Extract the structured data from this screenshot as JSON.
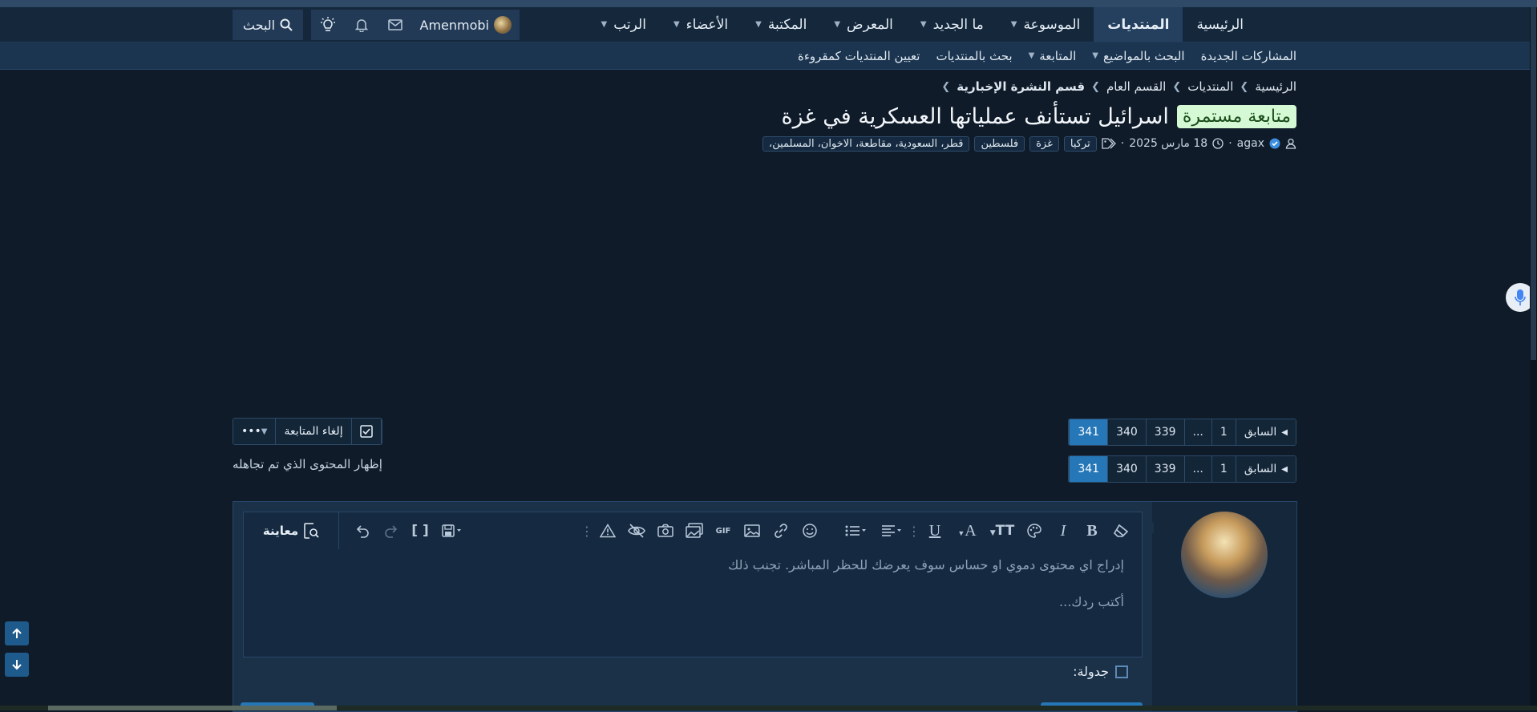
{
  "nav": {
    "tabs": [
      {
        "label": "الرئيسية",
        "active": false,
        "dropdown": false
      },
      {
        "label": "المنتديات",
        "active": true,
        "dropdown": false
      },
      {
        "label": "الموسوعة",
        "active": false,
        "dropdown": true
      },
      {
        "label": "ما الجديد",
        "active": false,
        "dropdown": true
      },
      {
        "label": "المعرض",
        "active": false,
        "dropdown": true
      },
      {
        "label": "المكتبة",
        "active": false,
        "dropdown": true
      },
      {
        "label": "الأعضاء",
        "active": false,
        "dropdown": true
      },
      {
        "label": "الرتب",
        "active": false,
        "dropdown": true
      }
    ],
    "username": "Amenmobi",
    "search_label": "البحث"
  },
  "subnav": {
    "items": [
      {
        "label": "المشاركات الجديدة",
        "dropdown": false
      },
      {
        "label": "البحث بالمواضيع",
        "dropdown": true
      },
      {
        "label": "المتابعة",
        "dropdown": true
      },
      {
        "label": "بحث بالمنتديات",
        "dropdown": false
      },
      {
        "label": "تعيين المنتديات كمقروءة",
        "dropdown": false
      }
    ]
  },
  "breadcrumb": [
    "الرئيسية",
    "المنتديات",
    "القسم العام",
    "قسم النشرة الإخبارية"
  ],
  "thread": {
    "prefix": "متابعة مستمرة",
    "title": "اسرائيل تستأنف عملياتها العسكرية في غزة",
    "author": "agax",
    "date": "18 مارس 2025",
    "tags": [
      "تركيا",
      "غزة",
      "فلسطين",
      "قطر، السعودية، مقاطعة، الاخوان، المسلمين،"
    ]
  },
  "pagination": {
    "prev_label": "السابق",
    "pages": [
      "1",
      "...",
      "339",
      "340",
      "341"
    ],
    "current": "341"
  },
  "thread_actions": {
    "unwatch_label": "إلغاء المتابعة",
    "more_label": "•••"
  },
  "show_ignored_label": "إظهار المحتوى الذي تم تجاهله",
  "editor": {
    "preview_label": "معاينة",
    "notice": "إدراج اي محتوى دموي او حساس سوف يعرضك للحظر المباشر. تجنب ذلك",
    "placeholder": "أكتب ردك...",
    "schedule_label": "جدولة:"
  },
  "colors": {
    "background": "#0f1b29",
    "navbar": "#14273b",
    "accent": "#2577b8",
    "prefix_bg": "#d4f9d4"
  }
}
